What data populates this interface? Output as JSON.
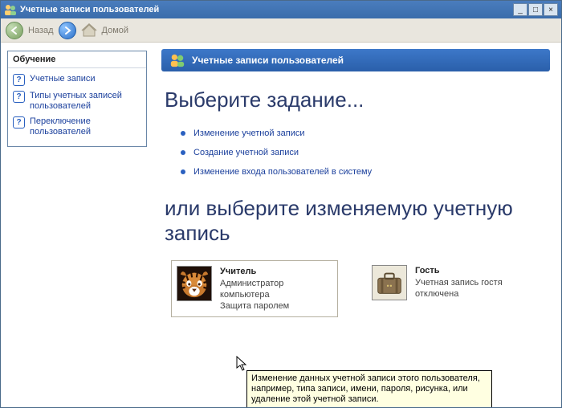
{
  "window": {
    "title": "Учетные записи пользователей"
  },
  "nav": {
    "back": "Назад",
    "home": "Домой"
  },
  "sidebar": {
    "heading": "Обучение",
    "items": [
      {
        "label": "Учетные записи"
      },
      {
        "label": "Типы учетных записей пользователей"
      },
      {
        "label": "Переключение пользователей"
      }
    ]
  },
  "header": {
    "title": "Учетные записи пользователей"
  },
  "main": {
    "h1": "Выберите задание...",
    "tasks": [
      {
        "label": "Изменение учетной записи"
      },
      {
        "label": "Создание учетной записи"
      },
      {
        "label": "Изменение входа пользователей в систему"
      }
    ],
    "h2": "или выберите изменяемую учетную запись"
  },
  "accounts": [
    {
      "name": "Учитель",
      "line1": "Администратор компьютера",
      "line2": "Защита паролем"
    },
    {
      "name": "Гость",
      "line1": "Учетная запись гостя отключена",
      "line2": ""
    }
  ],
  "tooltip": "Изменение данных учетной записи этого пользователя, например, типа записи, имени, пароля, рисунка, или удаление этой учетной записи."
}
